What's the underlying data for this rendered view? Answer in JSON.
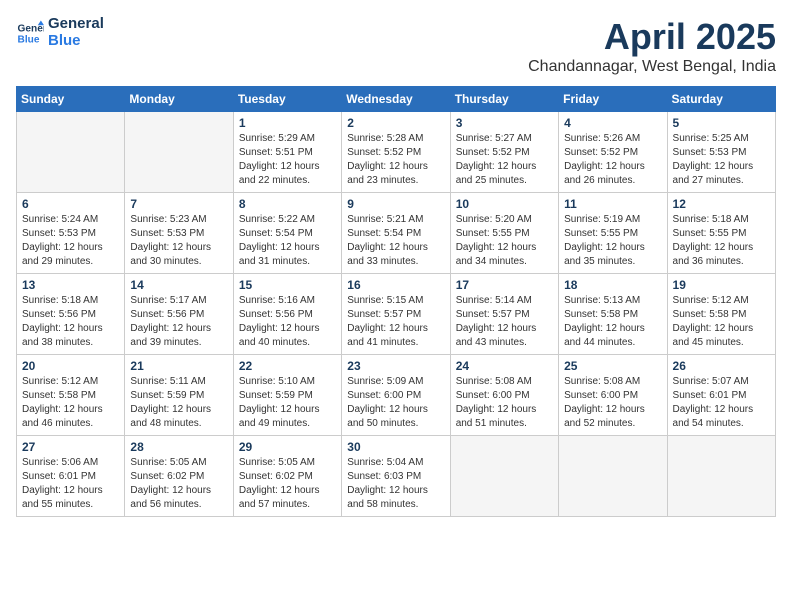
{
  "header": {
    "logo_line1": "General",
    "logo_line2": "Blue",
    "title": "April 2025",
    "location": "Chandannagar, West Bengal, India"
  },
  "calendar": {
    "days_of_week": [
      "Sunday",
      "Monday",
      "Tuesday",
      "Wednesday",
      "Thursday",
      "Friday",
      "Saturday"
    ],
    "weeks": [
      [
        {
          "day": "",
          "info": ""
        },
        {
          "day": "",
          "info": ""
        },
        {
          "day": "1",
          "info": "Sunrise: 5:29 AM\nSunset: 5:51 PM\nDaylight: 12 hours and 22 minutes."
        },
        {
          "day": "2",
          "info": "Sunrise: 5:28 AM\nSunset: 5:52 PM\nDaylight: 12 hours and 23 minutes."
        },
        {
          "day": "3",
          "info": "Sunrise: 5:27 AM\nSunset: 5:52 PM\nDaylight: 12 hours and 25 minutes."
        },
        {
          "day": "4",
          "info": "Sunrise: 5:26 AM\nSunset: 5:52 PM\nDaylight: 12 hours and 26 minutes."
        },
        {
          "day": "5",
          "info": "Sunrise: 5:25 AM\nSunset: 5:53 PM\nDaylight: 12 hours and 27 minutes."
        }
      ],
      [
        {
          "day": "6",
          "info": "Sunrise: 5:24 AM\nSunset: 5:53 PM\nDaylight: 12 hours and 29 minutes."
        },
        {
          "day": "7",
          "info": "Sunrise: 5:23 AM\nSunset: 5:53 PM\nDaylight: 12 hours and 30 minutes."
        },
        {
          "day": "8",
          "info": "Sunrise: 5:22 AM\nSunset: 5:54 PM\nDaylight: 12 hours and 31 minutes."
        },
        {
          "day": "9",
          "info": "Sunrise: 5:21 AM\nSunset: 5:54 PM\nDaylight: 12 hours and 33 minutes."
        },
        {
          "day": "10",
          "info": "Sunrise: 5:20 AM\nSunset: 5:55 PM\nDaylight: 12 hours and 34 minutes."
        },
        {
          "day": "11",
          "info": "Sunrise: 5:19 AM\nSunset: 5:55 PM\nDaylight: 12 hours and 35 minutes."
        },
        {
          "day": "12",
          "info": "Sunrise: 5:18 AM\nSunset: 5:55 PM\nDaylight: 12 hours and 36 minutes."
        }
      ],
      [
        {
          "day": "13",
          "info": "Sunrise: 5:18 AM\nSunset: 5:56 PM\nDaylight: 12 hours and 38 minutes."
        },
        {
          "day": "14",
          "info": "Sunrise: 5:17 AM\nSunset: 5:56 PM\nDaylight: 12 hours and 39 minutes."
        },
        {
          "day": "15",
          "info": "Sunrise: 5:16 AM\nSunset: 5:56 PM\nDaylight: 12 hours and 40 minutes."
        },
        {
          "day": "16",
          "info": "Sunrise: 5:15 AM\nSunset: 5:57 PM\nDaylight: 12 hours and 41 minutes."
        },
        {
          "day": "17",
          "info": "Sunrise: 5:14 AM\nSunset: 5:57 PM\nDaylight: 12 hours and 43 minutes."
        },
        {
          "day": "18",
          "info": "Sunrise: 5:13 AM\nSunset: 5:58 PM\nDaylight: 12 hours and 44 minutes."
        },
        {
          "day": "19",
          "info": "Sunrise: 5:12 AM\nSunset: 5:58 PM\nDaylight: 12 hours and 45 minutes."
        }
      ],
      [
        {
          "day": "20",
          "info": "Sunrise: 5:12 AM\nSunset: 5:58 PM\nDaylight: 12 hours and 46 minutes."
        },
        {
          "day": "21",
          "info": "Sunrise: 5:11 AM\nSunset: 5:59 PM\nDaylight: 12 hours and 48 minutes."
        },
        {
          "day": "22",
          "info": "Sunrise: 5:10 AM\nSunset: 5:59 PM\nDaylight: 12 hours and 49 minutes."
        },
        {
          "day": "23",
          "info": "Sunrise: 5:09 AM\nSunset: 6:00 PM\nDaylight: 12 hours and 50 minutes."
        },
        {
          "day": "24",
          "info": "Sunrise: 5:08 AM\nSunset: 6:00 PM\nDaylight: 12 hours and 51 minutes."
        },
        {
          "day": "25",
          "info": "Sunrise: 5:08 AM\nSunset: 6:00 PM\nDaylight: 12 hours and 52 minutes."
        },
        {
          "day": "26",
          "info": "Sunrise: 5:07 AM\nSunset: 6:01 PM\nDaylight: 12 hours and 54 minutes."
        }
      ],
      [
        {
          "day": "27",
          "info": "Sunrise: 5:06 AM\nSunset: 6:01 PM\nDaylight: 12 hours and 55 minutes."
        },
        {
          "day": "28",
          "info": "Sunrise: 5:05 AM\nSunset: 6:02 PM\nDaylight: 12 hours and 56 minutes."
        },
        {
          "day": "29",
          "info": "Sunrise: 5:05 AM\nSunset: 6:02 PM\nDaylight: 12 hours and 57 minutes."
        },
        {
          "day": "30",
          "info": "Sunrise: 5:04 AM\nSunset: 6:03 PM\nDaylight: 12 hours and 58 minutes."
        },
        {
          "day": "",
          "info": ""
        },
        {
          "day": "",
          "info": ""
        },
        {
          "day": "",
          "info": ""
        }
      ]
    ]
  }
}
